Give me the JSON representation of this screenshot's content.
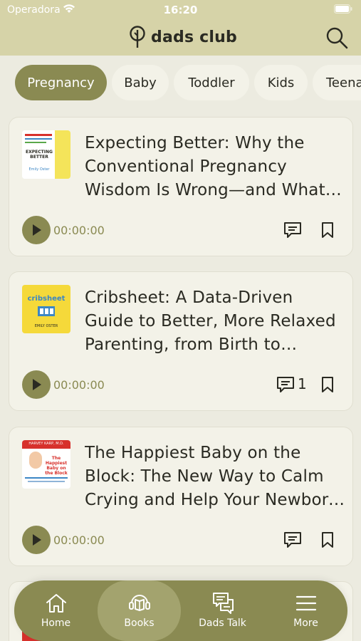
{
  "status_bar": {
    "carrier": "Operadora",
    "time": "16:20"
  },
  "header": {
    "brand": "dads club",
    "search_icon": "search-icon",
    "logo_icon": "tree-icon"
  },
  "tabs": [
    {
      "label": "Pregnancy",
      "active": true
    },
    {
      "label": "Baby",
      "active": false
    },
    {
      "label": "Toddler",
      "active": false
    },
    {
      "label": "Kids",
      "active": false
    },
    {
      "label": "Teena",
      "active": false
    }
  ],
  "books": [
    {
      "title": "Expecting Better: Why the Conventional Pregnancy Wisdom Is Wrong—and What You Really Need to Know",
      "duration": "00:00:00",
      "comments": "",
      "cover": {
        "title": "EXPECTING BETTER",
        "author": "Emily Oster",
        "bg": "#ffffff",
        "accent": "#f4e45a"
      }
    },
    {
      "title": "Cribsheet: A Data-Driven Guide to Better, More Relaxed Parenting, from Birth to Preschool",
      "duration": "00:00:00",
      "comments": "1",
      "cover": {
        "title": "cribsheet",
        "author": "EMILY OSTER",
        "bg": "#f5d93a",
        "accent": "#3b86c5"
      }
    },
    {
      "title": "The Happiest Baby on the Block: The New Way to Calm Crying and Help Your Newborn Baby Sleep Longer",
      "duration": "00:00:00",
      "comments": "",
      "cover": {
        "title": "The Happiest Baby on the Block",
        "author": "HARVEY KARP, M.D.",
        "bg": "#ffffff",
        "accent": "#d7312c"
      }
    }
  ],
  "nav": [
    {
      "label": "Home",
      "icon": "home-icon",
      "active": false
    },
    {
      "label": "Books",
      "icon": "book-audio-icon",
      "active": true
    },
    {
      "label": "Dads Talk",
      "icon": "chat-icon",
      "active": false
    },
    {
      "label": "More",
      "icon": "menu-icon",
      "active": false
    }
  ],
  "colors": {
    "header": "#d6d3a8",
    "accent": "#8a8a52",
    "card": "#f3f2e8",
    "background": "#ecebe0"
  }
}
